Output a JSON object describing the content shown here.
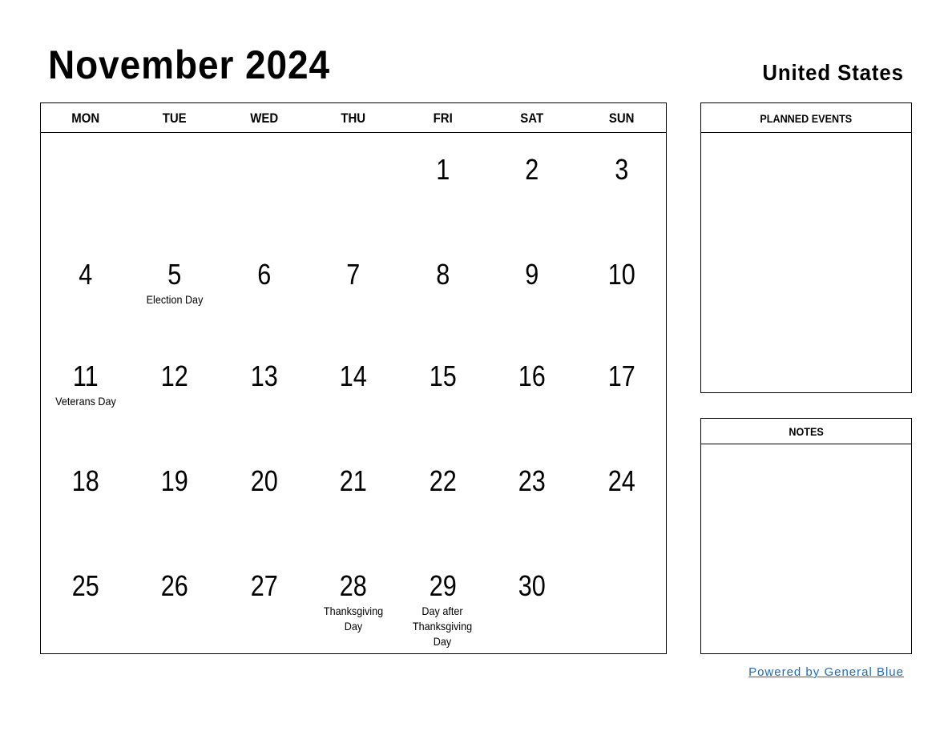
{
  "header": {
    "title": "November 2024",
    "country": "United States"
  },
  "calendar": {
    "weekdays": [
      "MON",
      "TUE",
      "WED",
      "THU",
      "FRI",
      "SAT",
      "SUN"
    ],
    "weeks": [
      [
        {
          "day": ""
        },
        {
          "day": ""
        },
        {
          "day": ""
        },
        {
          "day": ""
        },
        {
          "day": "1"
        },
        {
          "day": "2"
        },
        {
          "day": "3"
        }
      ],
      [
        {
          "day": "4"
        },
        {
          "day": "5",
          "holiday": "Election Day"
        },
        {
          "day": "6"
        },
        {
          "day": "7"
        },
        {
          "day": "8"
        },
        {
          "day": "9"
        },
        {
          "day": "10"
        }
      ],
      [
        {
          "day": "11",
          "holiday": "Veterans Day"
        },
        {
          "day": "12"
        },
        {
          "day": "13"
        },
        {
          "day": "14"
        },
        {
          "day": "15"
        },
        {
          "day": "16"
        },
        {
          "day": "17"
        }
      ],
      [
        {
          "day": "18"
        },
        {
          "day": "19"
        },
        {
          "day": "20"
        },
        {
          "day": "21"
        },
        {
          "day": "22"
        },
        {
          "day": "23"
        },
        {
          "day": "24"
        }
      ],
      [
        {
          "day": "25"
        },
        {
          "day": "26"
        },
        {
          "day": "27"
        },
        {
          "day": "28",
          "holiday": "Thanksgiving Day"
        },
        {
          "day": "29",
          "holiday": "Day after Thanksgiving Day"
        },
        {
          "day": "30"
        },
        {
          "day": ""
        }
      ]
    ]
  },
  "panels": {
    "planned_events": "PLANNED EVENTS",
    "notes": "NOTES"
  },
  "footer": {
    "powered_by": "Powered by General Blue",
    "link_color": "#1f6bb5"
  }
}
